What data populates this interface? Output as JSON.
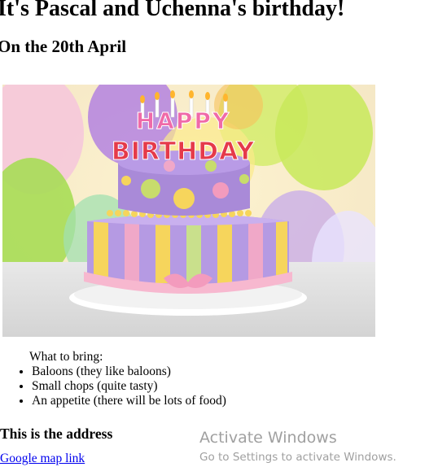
{
  "page": {
    "heading": "It's Pascal and Uchenna's birthday!",
    "subheading": "On the 20th April"
  },
  "image": {
    "cake_topper_line1": "HAPPY",
    "cake_topper_line2": "BIRTHDAY"
  },
  "bring": {
    "title": "What to bring:",
    "items": [
      "Baloons (they like baloons)",
      "Small chops (quite tasty)",
      "An appetite (there will be lots of food)"
    ]
  },
  "address": {
    "heading": "This is the address",
    "link_text": "Google map link"
  },
  "watermark": {
    "title": "Activate Windows",
    "subtitle": "Go to Settings to activate Windows."
  },
  "colors": {
    "link": "#0000ee",
    "watermark": "#a0a0a0"
  }
}
